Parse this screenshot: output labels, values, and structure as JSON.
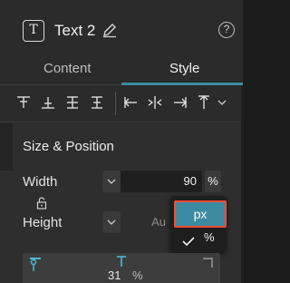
{
  "header": {
    "type_icon_glyph": "T",
    "title": "Text 2",
    "help_glyph": "?"
  },
  "tabs": [
    {
      "label": "Content",
      "active": false
    },
    {
      "label": "Style",
      "active": true
    }
  ],
  "toolbar": {
    "tools": [
      "align-top-icon",
      "align-bottom-icon",
      "align-middle-icon",
      "distribute-icon",
      "align-left-edge-icon",
      "align-center-h-icon",
      "align-right-edge-icon",
      "align-top-edge-icon",
      "chevron-down-icon"
    ]
  },
  "section": {
    "title": "Size & Position",
    "width": {
      "label": "Width",
      "value": "90",
      "unit": "%"
    },
    "height": {
      "label": "Height",
      "value": "Au"
    },
    "position": {
      "value": "31",
      "unit": "%"
    }
  },
  "unit_dropdown": {
    "options": [
      {
        "label": "px",
        "highlighted": true
      },
      {
        "label": "%",
        "checked": true
      }
    ]
  },
  "colors": {
    "accent": "#3b8aa1",
    "highlight_border": "#ff4b36",
    "panel_bg": "#2b2b2b"
  }
}
